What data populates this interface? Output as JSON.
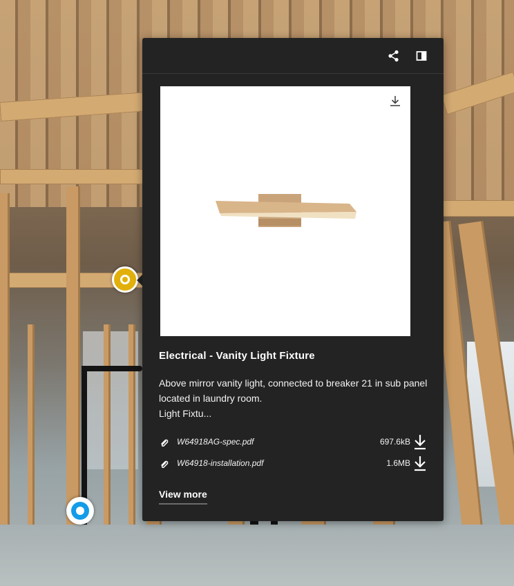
{
  "icons": {
    "share": "share-icon",
    "sidebar": "sidebar-toggle-icon",
    "image_download": "download-icon",
    "attachment": "paperclip-icon",
    "file_download": "download-arrow-icon"
  },
  "colors": {
    "panel_bg": "#232323",
    "hotspot_yellow": "#e1b00b",
    "hotspot_blue": "#139ce8"
  },
  "tag": {
    "title": "Electrical - Vanity Light Fixture",
    "description_line1": "Above mirror vanity light, connected to breaker 21 in sub panel located in laundry room.",
    "description_line2": "Light Fixtu...",
    "attachments": [
      {
        "name": "W64918AG-spec.pdf",
        "size": "697.6kB"
      },
      {
        "name": "W64918-installation.pdf",
        "size": "1.6MB"
      }
    ],
    "view_more": "View more"
  }
}
